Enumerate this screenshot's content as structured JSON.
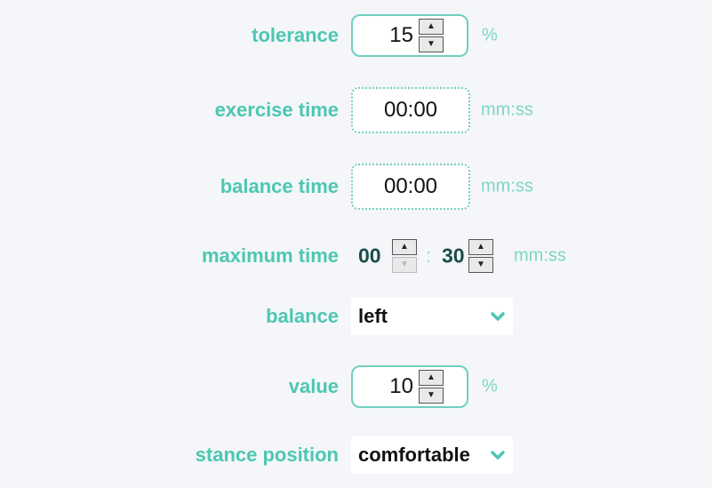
{
  "tolerance": {
    "label": "tolerance",
    "value": "15",
    "unit": "%"
  },
  "exercise_time": {
    "label": "exercise time",
    "value": "00:00",
    "unit": "mm:ss"
  },
  "balance_time": {
    "label": "balance time",
    "value": "00:00",
    "unit": "mm:ss"
  },
  "maximum_time": {
    "label": "maximum time",
    "minutes": "00",
    "separator": ":",
    "seconds": "30",
    "unit": "mm:ss"
  },
  "balance": {
    "label": "balance",
    "selected": "left"
  },
  "value": {
    "label": "value",
    "value": "10",
    "unit": "%"
  },
  "stance_position": {
    "label": "stance position",
    "selected": "comfortable"
  },
  "icons": {
    "spin_up": "▲",
    "spin_down": "▼",
    "dropdown": "chevron-down-icon"
  },
  "colors": {
    "accent": "#4cc7b2",
    "border": "#6fcfbe",
    "background": "#f4f6f9"
  }
}
